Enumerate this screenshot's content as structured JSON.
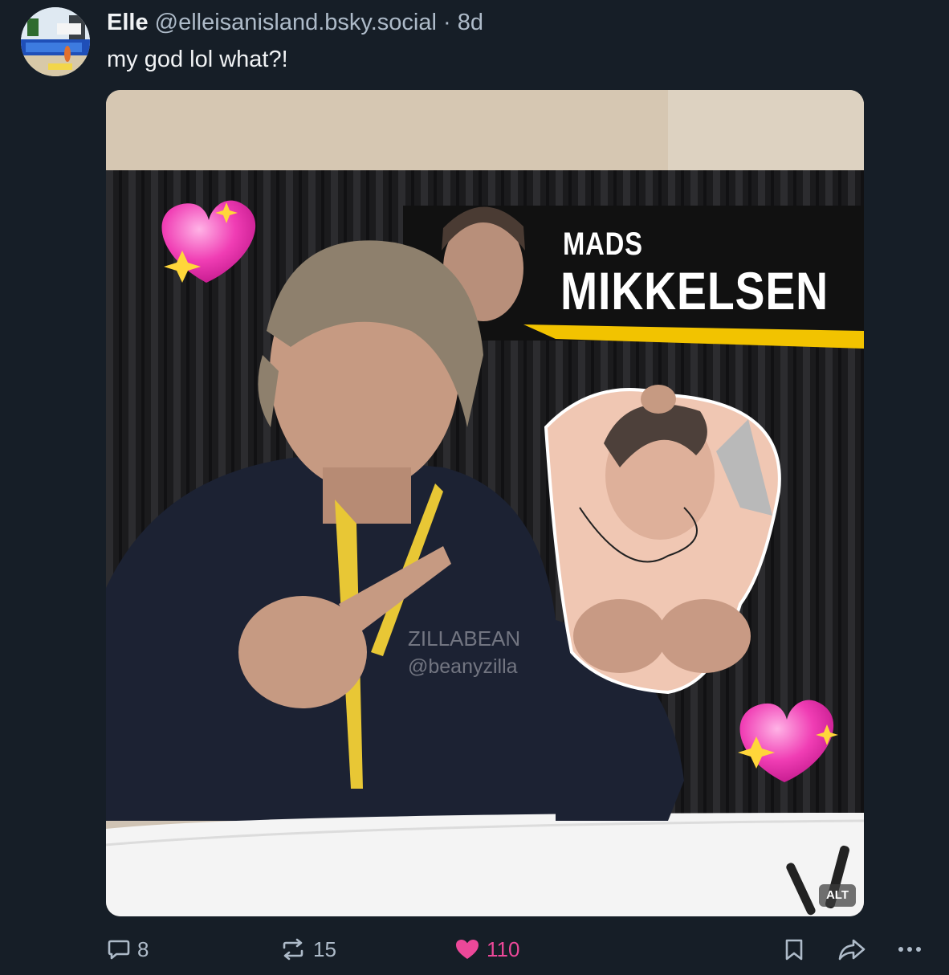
{
  "post": {
    "author": {
      "display_name": "Elle",
      "handle": "@elleisanisland.bsky.social",
      "separator": "·",
      "age": "8d"
    },
    "text": "my god lol what?!",
    "image": {
      "banner_first_name": "MADS",
      "banner_last_name": "MIKKELSEN",
      "watermark_line1": "ZILLABEAN",
      "watermark_line2": "@beanyzilla",
      "alt_label": "ALT"
    },
    "actions": {
      "reply_count": "8",
      "repost_count": "15",
      "like_count": "110"
    }
  },
  "colors": {
    "background": "#161e27",
    "text_primary": "#f1f3f5",
    "text_secondary": "#aebbc9",
    "like_pink": "#ec4899",
    "banner_yellow": "#f2c300"
  },
  "icons": [
    "reply-icon",
    "repost-icon",
    "heart-icon",
    "bookmark-icon",
    "share-icon",
    "more-icon"
  ]
}
